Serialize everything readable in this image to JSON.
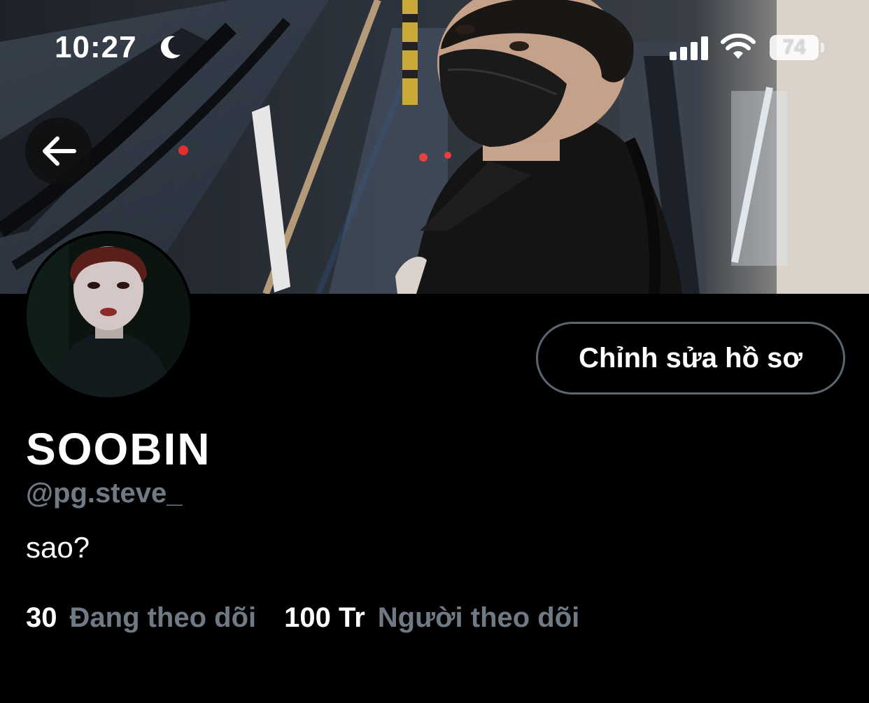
{
  "status_bar": {
    "time": "10:27",
    "battery_level": "74"
  },
  "profile": {
    "display_name": "SOOBIN",
    "username": "@pg.steve_",
    "bio": "sao?",
    "edit_button_label": "Chỉnh sửa hồ sơ"
  },
  "stats": {
    "following_count": "30",
    "following_label": "Đang theo dõi",
    "followers_count": "100 Tr",
    "followers_label": "Người theo dõi"
  },
  "colors": {
    "background": "#000000",
    "secondary_text": "#6f7a85",
    "button_border": "#5c6670"
  },
  "icons": [
    "moon-icon",
    "signal-icon",
    "wifi-icon",
    "battery-icon",
    "back-arrow-icon"
  ]
}
